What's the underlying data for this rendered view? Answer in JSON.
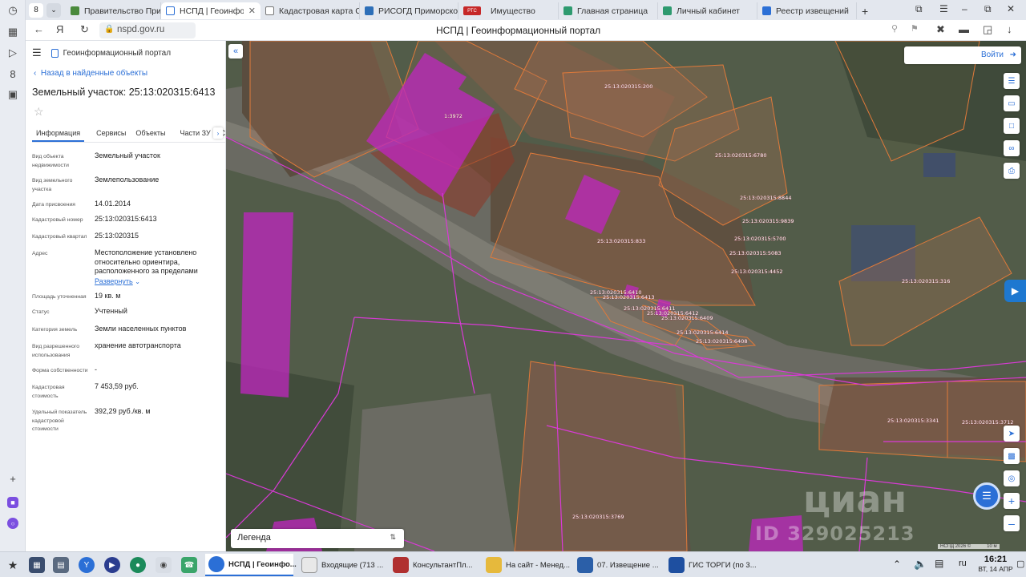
{
  "browser": {
    "tab_count": "8",
    "tabs": [
      {
        "label": "Правительство Примор",
        "color": "#4a8a3c"
      },
      {
        "label": "НСПД | Геоинформа",
        "color": "#2b6fd6",
        "active": true
      },
      {
        "label": "Кадастровая карта Сиб",
        "color": "#777777"
      },
      {
        "label": "РИСОГД Приморского",
        "color": "#2d6fb8"
      },
      {
        "label": "Имущество",
        "color": "#c62828",
        "badge": "РТС"
      },
      {
        "label": "Главная страница",
        "color": "#2e9a6f"
      },
      {
        "label": "Личный кабинет",
        "color": "#2e9a6f"
      },
      {
        "label": "Реестр извещений",
        "color": "#2b6fd6"
      }
    ],
    "url": "nspd.gov.ru",
    "page_title": "НСПД | Геоинформационный портал"
  },
  "panel": {
    "portal_name": "Геоинформационный портал",
    "back_label": "Назад в найденные объекты",
    "title": "Земельный участок: 25:13:020315:6413",
    "tabs": [
      "Информация",
      "Сервисы",
      "Объекты",
      "Части ЗУ",
      "Соста"
    ],
    "fields": [
      {
        "key": "Вид объекта недвижимости",
        "value": "Земельный участок"
      },
      {
        "key": "Вид земельного участка",
        "value": "Землепользование"
      },
      {
        "key": "Дата присвоения",
        "value": "14.01.2014"
      },
      {
        "key": "Кадастровый номер",
        "value": "25:13:020315:6413"
      },
      {
        "key": "Кадастровый квартал",
        "value": "25:13:020315"
      },
      {
        "key": "Адрес",
        "value": "Местоположение установлено относительно ориентира, расположенного за пределами",
        "expand": "Развернуть"
      },
      {
        "key": "Площадь уточненная",
        "value": "19 кв. м"
      },
      {
        "key": "Статус",
        "value": "Учтенный"
      },
      {
        "key": "Категория земель",
        "value": "Земли населенных пунктов"
      },
      {
        "key": "Вид разрешенного использования",
        "value": "хранение автотранспорта"
      },
      {
        "key": "Форма собственности",
        "value": "-"
      },
      {
        "key": "Кадастровая стоимость",
        "value": "7 453,59 руб."
      },
      {
        "key": "Удельный показатель кадастровой стоимости",
        "value": "392,29 руб./кв. м"
      }
    ]
  },
  "map": {
    "login_label": "Войти",
    "legend_label": "Легенда",
    "watermark_brand": "циан",
    "watermark_id": "ID 329025213",
    "attribution": "НСПД 2026 ©",
    "scale_label": "10 м",
    "parcel_labels": [
      "25:13:020315:200",
      "1:3972",
      "25:13:020315:6780",
      "25:13:020315:8844",
      "25:13:020315:9839",
      "25:13:020315:5700",
      "25:13:020315:5083",
      "25:13:020315:4452",
      "25:13:020315:833",
      "25:13:020315:6410",
      "25:13:020315:6413",
      "25:13:020315:6411",
      "25:13:020315:6412",
      "25:13:020315:6409",
      "25:13:020315:6414",
      "25:13:020315:6408",
      "25:13:020315:316",
      "25:13:020315:3341",
      "25:13:020315:3712",
      "25:13:020315:3769"
    ]
  },
  "taskbar": {
    "windows": [
      {
        "label": "НСПД | Геоинфо...",
        "color": "#2b6fd6",
        "active": true
      },
      {
        "label": "Входящие (713 ...",
        "color": "#e8e8e8"
      },
      {
        "label": "КонсультантПл...",
        "color": "#b03030"
      },
      {
        "label": "На сайт - Менед...",
        "color": "#e6b93c"
      },
      {
        "label": "07. Извещение ...",
        "color": "#2b5fa8"
      },
      {
        "label": "ГИС ТОРГИ (по 3...",
        "color": "#1e4fa0"
      }
    ],
    "lang": "ru",
    "time": "16:21",
    "date": "ВТ, 14 АПР"
  }
}
